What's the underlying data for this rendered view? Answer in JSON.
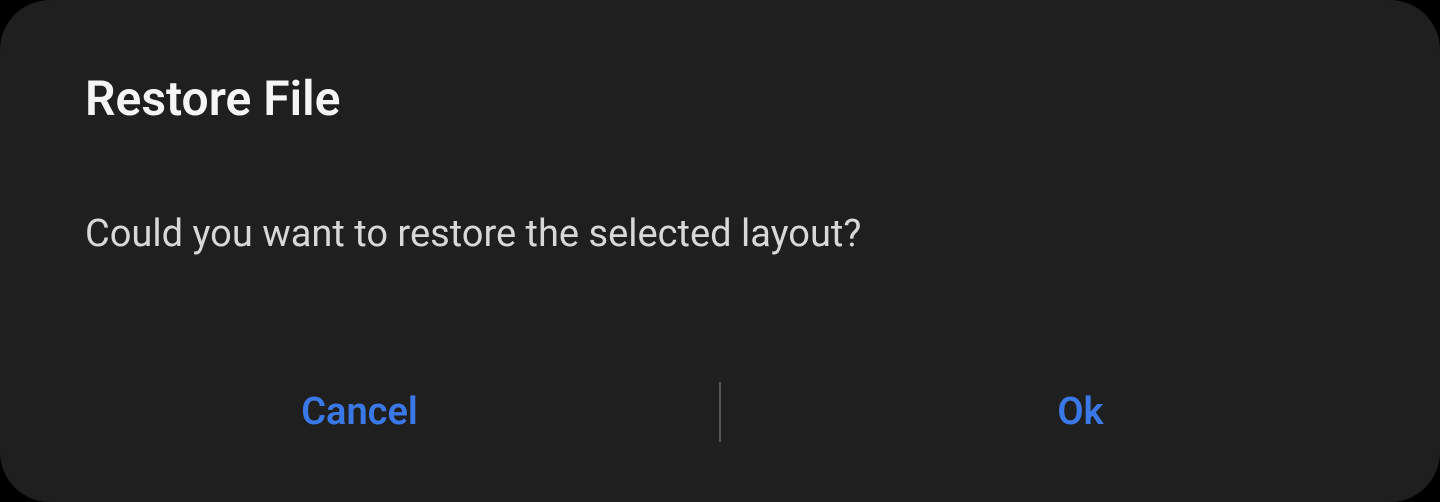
{
  "dialog": {
    "title": "Restore File",
    "message": "Could you want to restore the selected layout?",
    "buttons": {
      "cancel": "Cancel",
      "ok": "Ok"
    }
  }
}
